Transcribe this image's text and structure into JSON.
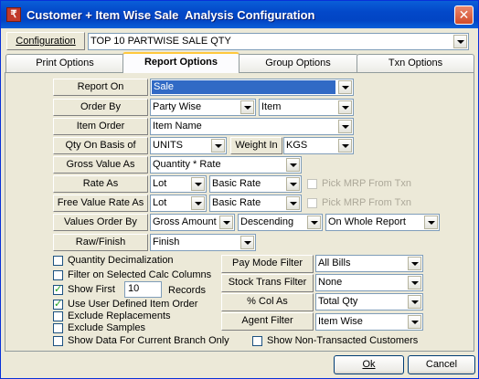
{
  "window": {
    "title": "Customer + Item Wise Sale  Analysis Configuration",
    "close_glyph": "✕"
  },
  "configuration": {
    "label": "Configuration",
    "value": "TOP 10 PARTWISE SALE QTY"
  },
  "tabs": [
    {
      "label": "Print Options",
      "active": false
    },
    {
      "label": "Report Options",
      "active": true
    },
    {
      "label": "Group Options",
      "active": false
    },
    {
      "label": "Txn Options",
      "active": false
    }
  ],
  "fields": {
    "report_on": {
      "label": "Report On",
      "value": "Sale"
    },
    "order_by": {
      "label": "Order By",
      "value1": "Party Wise",
      "value2": "Item"
    },
    "item_order": {
      "label": "Item Order",
      "value": "Item Name"
    },
    "qty_basis": {
      "label": "Qty On Basis of",
      "value": "UNITS",
      "weight_label": "Weight In",
      "weight_value": "KGS"
    },
    "gross_value": {
      "label": "Gross Value As",
      "value": "Quantity * Rate"
    },
    "rate_as": {
      "label": "Rate As",
      "value1": "Lot",
      "value2": "Basic Rate",
      "mrp_label": "Pick MRP From Txn"
    },
    "free_rate": {
      "label": "Free Value Rate As",
      "value1": "Lot",
      "value2": "Basic Rate",
      "mrp_label": "Pick MRP From Txn"
    },
    "values_order": {
      "label": "Values Order By",
      "value1": "Gross Amount",
      "value2": "Descending",
      "value3": "On Whole Report"
    },
    "raw_finish": {
      "label": "Raw/Finish",
      "value": "Finish"
    }
  },
  "checkboxes": {
    "quantity_decimalization": {
      "label": "Quantity Decimalization",
      "checked": false
    },
    "filter_calc": {
      "label": "Filter on Selected Calc Columns",
      "checked": false
    },
    "show_first": {
      "label": "Show First",
      "checked": true,
      "count": "10",
      "suffix": "Records"
    },
    "user_item_order": {
      "label": "Use User Defined Item Order",
      "checked": true
    },
    "exclude_replacements": {
      "label": "Exclude Replacements",
      "checked": false
    },
    "exclude_samples": {
      "label": "Exclude Samples",
      "checked": false
    },
    "current_branch": {
      "label": "Show Data For Current Branch Only",
      "checked": false
    },
    "non_transacted": {
      "label": "Show Non-Transacted Customers",
      "checked": false
    }
  },
  "filters": {
    "pay_mode": {
      "label": "Pay Mode Filter",
      "value": "All Bills"
    },
    "stock_trans": {
      "label": "Stock Trans Filter",
      "value": "None"
    },
    "col_as": {
      "label": "% Col As",
      "value": "Total Qty"
    },
    "agent": {
      "label": "Agent Filter",
      "value": "Item Wise"
    }
  },
  "buttons": {
    "ok": "Ok",
    "cancel": "Cancel"
  }
}
